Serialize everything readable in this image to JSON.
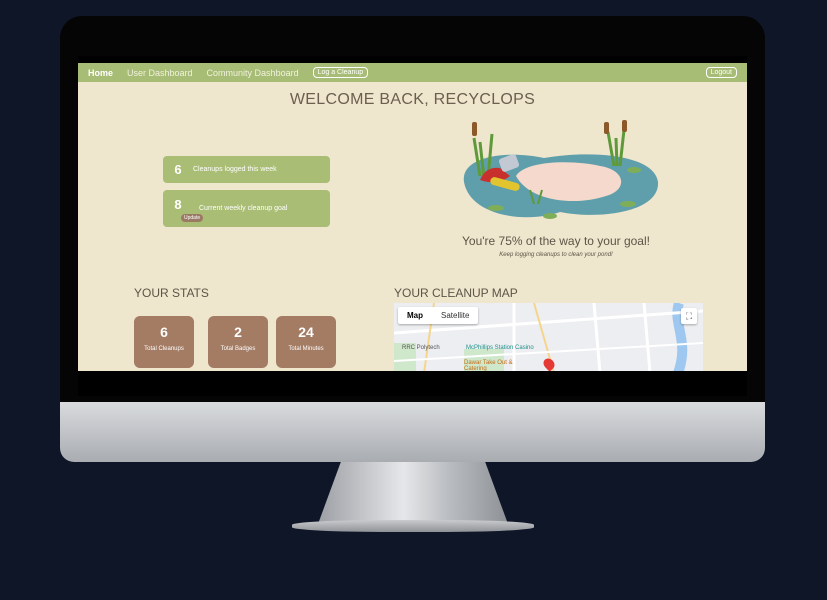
{
  "nav": {
    "home": "Home",
    "user_dashboard": "User Dashboard",
    "community_dashboard": "Community Dashboard",
    "log_cleanup": "Log a Cleanup",
    "logout": "Logout"
  },
  "welcome": "WELCOME BACK, RECYCLOPS",
  "weekly": {
    "logged_count": "6",
    "logged_label": "Cleanups logged this week",
    "goal_count": "8",
    "goal_label": "Current weekly cleanup goal",
    "update_label": "Update"
  },
  "progress": {
    "headline": "You're 75% of the way to your goal!",
    "subtext": "Keep logging cleanups to clean your pond!",
    "percent": 75
  },
  "stats": {
    "title": "YOUR STATS",
    "items": [
      {
        "value": "6",
        "label": "Total Cleanups"
      },
      {
        "value": "2",
        "label": "Total Badges"
      },
      {
        "value": "24",
        "label": "Total Minutes"
      }
    ]
  },
  "map": {
    "title": "YOUR CLEANUP MAP",
    "tab_map": "Map",
    "tab_satellite": "Satellite",
    "labels": [
      "RRC Polytech",
      "McPhillips Station Casino",
      "Dawar Take Out & Catering"
    ]
  },
  "colors": {
    "background": "#efe6ce",
    "nav": "#a7bc74",
    "card_green": "#a9bd74",
    "stat_brown": "#a47b63",
    "text": "#5c5546"
  }
}
